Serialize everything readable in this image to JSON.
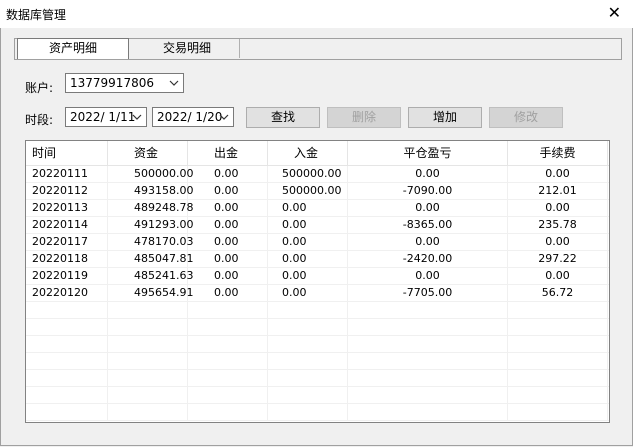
{
  "window": {
    "title": "数据库管理"
  },
  "tabs": [
    {
      "label": "资产明细",
      "active": true
    },
    {
      "label": "交易明细",
      "active": false
    }
  ],
  "form": {
    "account_label": "账户:",
    "account_value": "13779917806",
    "period_label": "时段:",
    "date_from": "2022/ 1/11",
    "date_to": "2022/ 1/20"
  },
  "buttons": {
    "search": "查找",
    "delete": "删除",
    "add": "增加",
    "edit": "修改"
  },
  "table": {
    "columns": [
      "时间",
      "资金",
      "出金",
      "入金",
      "平仓盈亏",
      "手续费"
    ],
    "rows": [
      [
        "20220111",
        "500000.00",
        "0.00",
        "500000.00",
        "0.00",
        "0.00"
      ],
      [
        "20220112",
        "493158.00",
        "0.00",
        "500000.00",
        "-7090.00",
        "212.01"
      ],
      [
        "20220113",
        "489248.78",
        "0.00",
        "0.00",
        "0.00",
        "0.00"
      ],
      [
        "20220114",
        "491293.00",
        "0.00",
        "0.00",
        "-8365.00",
        "235.78"
      ],
      [
        "20220117",
        "478170.03",
        "0.00",
        "0.00",
        "0.00",
        "0.00"
      ],
      [
        "20220118",
        "485047.81",
        "0.00",
        "0.00",
        "-2420.00",
        "297.22"
      ],
      [
        "20220119",
        "485241.63",
        "0.00",
        "0.00",
        "0.00",
        "0.00"
      ],
      [
        "20220120",
        "495654.91",
        "0.00",
        "0.00",
        "-7705.00",
        "56.72"
      ]
    ]
  }
}
